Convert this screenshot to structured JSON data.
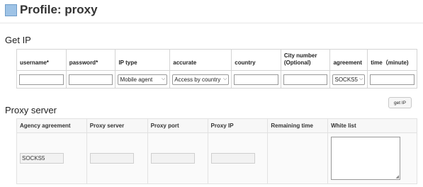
{
  "page": {
    "title": "Profile: proxy"
  },
  "get_ip": {
    "title": "Get IP",
    "columns": [
      "username*",
      "password*",
      "IP type",
      "accurate",
      "country",
      "City number\n(Optional)",
      "agreement",
      "time（minute)"
    ],
    "inputs": {
      "username": "",
      "password": "",
      "ip_type": "Mobile agent",
      "accurate": "Access by country",
      "country": "",
      "city_number": "",
      "agreement": "SOCKS5",
      "time": ""
    },
    "button_label": "get IP"
  },
  "proxy_server": {
    "title": "Proxy server",
    "columns": [
      "Agency agreement",
      "Proxy server",
      "Proxy port",
      "Proxy IP",
      "Remaining time",
      "White list"
    ],
    "values": {
      "agency_agreement": "SOCKS5",
      "proxy_server": "",
      "proxy_port": "",
      "proxy_ip": "",
      "remaining_time": "",
      "white_list": ""
    }
  }
}
